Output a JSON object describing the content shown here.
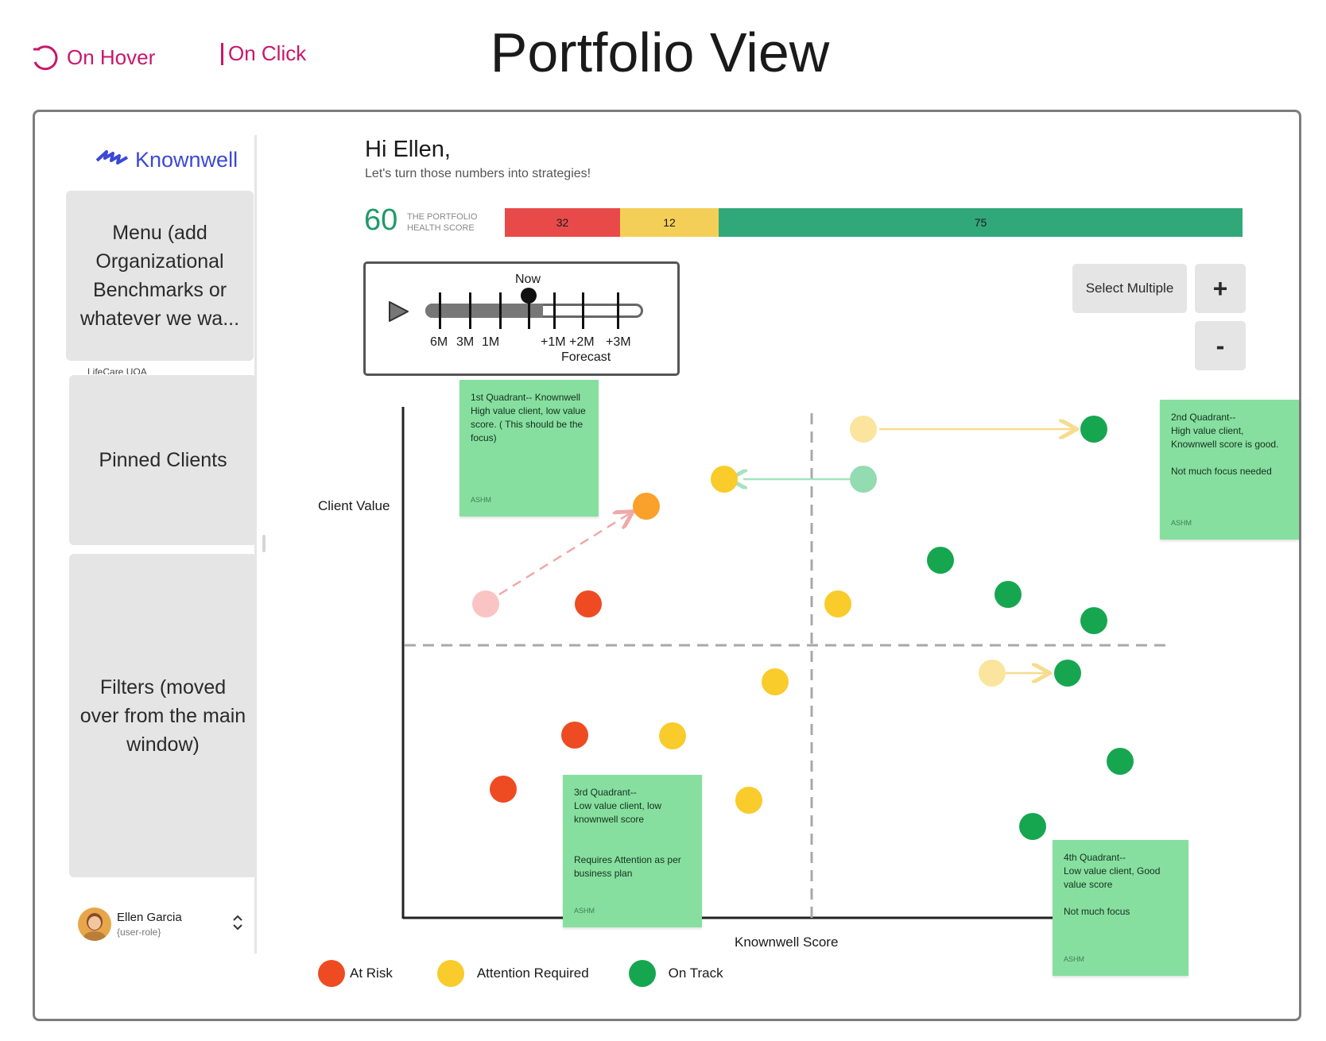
{
  "legend": {
    "hover_label": "On Hover",
    "click_label": "On Click",
    "accent": "#c8176b"
  },
  "page_title": "Portfolio View",
  "sidebar": {
    "logo_text": "Knownwell",
    "menu_text": "Menu (add Organizational Benchmarks or whatever we wa...",
    "lifecare_text": "LifeCare UOA",
    "pinned_text": "Pinned Clients",
    "filters_text": "Filters (moved over from the main window)",
    "user": {
      "name": "Ellen Garcia",
      "role": "{user-role}"
    }
  },
  "header": {
    "greeting": "Hi Ellen,",
    "subtitle": "Let's turn those numbers into strategies!"
  },
  "health": {
    "score": "60",
    "label_line1": "THE PORTFOLIO",
    "label_line2": "HEALTH SCORE",
    "segments": [
      {
        "value": "32",
        "color": "#e84a4a"
      },
      {
        "value": "12",
        "color": "#f3cf57"
      },
      {
        "value": "75",
        "color": "#31a87a"
      }
    ]
  },
  "timeline": {
    "now_label": "Now",
    "ticks": [
      "6M",
      "3M",
      "1M",
      "+1M",
      "+2M",
      "+3M"
    ],
    "forecast_label": "Forecast"
  },
  "controls": {
    "select_multiple": "Select Multiple",
    "zoom_in": "+",
    "zoom_out": "-"
  },
  "chart": {
    "y_label": "Client Value",
    "x_label": "Knownwell Score"
  },
  "notes": {
    "q1": {
      "text": "1st Quadrant-- Knownwell High value client, low value score. ( This should be the focus)",
      "sig": "ASHM"
    },
    "q2": {
      "line1": "2nd Quadrant--",
      "line2": "High value client,",
      "line3": "Knownwell score is good.",
      "line4": "Not much focus needed",
      "sig": "ASHM"
    },
    "q3": {
      "line1": "3rd Quadrant--",
      "line2": "Low value client, low knownwell score",
      "line3": "Requires Attention as per business plan",
      "sig": "ASHM"
    },
    "q4": {
      "line1": "4th Quadrant--",
      "line2": "Low value client, Good value score",
      "line3": "Not much focus",
      "sig": "ASHM"
    }
  },
  "status_legend": [
    {
      "label": "At Risk",
      "color": "#ee4b22"
    },
    {
      "label": "Attention Required",
      "color": "#f9cb2b"
    },
    {
      "label": "On Track",
      "color": "#17a650"
    }
  ]
}
